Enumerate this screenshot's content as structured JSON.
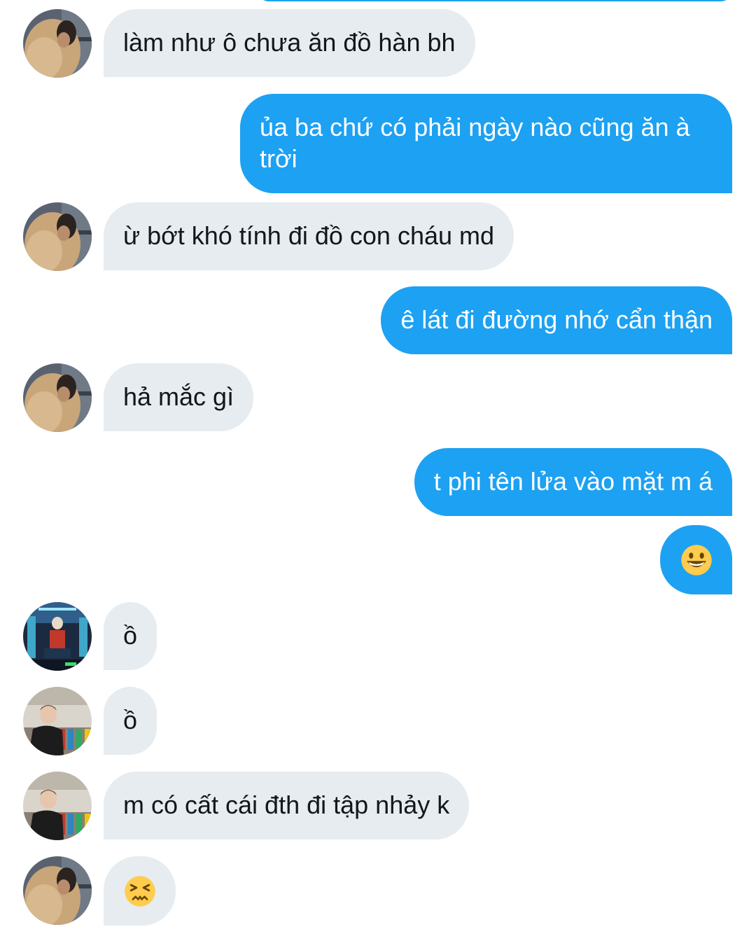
{
  "messages": [
    {
      "dir": "in",
      "avatar": "avatar-hooded",
      "text": "làm như ô chưa ăn đồ hàn bh"
    },
    {
      "dir": "out",
      "text": "ủa ba chứ có phải ngày nào cũng ăn à trời"
    },
    {
      "dir": "in",
      "avatar": "avatar-hooded",
      "text": "ừ bớt khó tính đi đồ con cháu md"
    },
    {
      "dir": "out",
      "text": "ê lát đi đường nhớ cẩn thận"
    },
    {
      "dir": "in",
      "avatar": "avatar-hooded",
      "text": "hả mắc gì"
    },
    {
      "dir": "out",
      "text": "t phi tên lửa vào mặt m á"
    },
    {
      "dir": "out",
      "emoji": "grinning-face-emoji"
    },
    {
      "dir": "in",
      "avatar": "avatar-neon",
      "text": "ồ"
    },
    {
      "dir": "in",
      "avatar": "avatar-suit",
      "text": "ồ"
    },
    {
      "dir": "in",
      "avatar": "avatar-suit",
      "text": "m có cất cái đth đi tập nhảy k"
    },
    {
      "dir": "in",
      "avatar": "avatar-hooded",
      "emoji": "persevering-face-emoji"
    }
  ],
  "colors": {
    "outgoing_bubble": "#1da1f2",
    "incoming_bubble": "#e6ecf0",
    "incoming_text": "#14171a",
    "outgoing_text": "#ffffff",
    "emoji_yellow": "#ffcc4d"
  }
}
